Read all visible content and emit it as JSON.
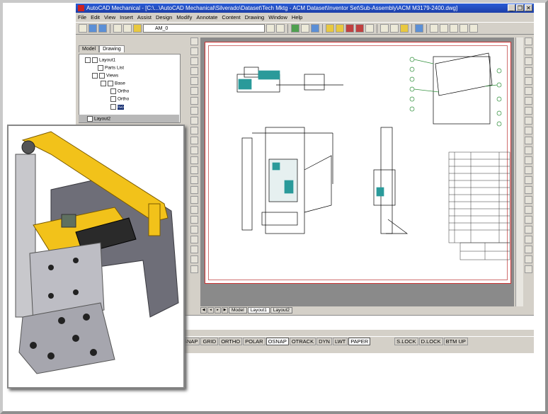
{
  "window": {
    "title": "AutoCAD Mechanical - [C:\\...\\AutoCAD Mechanical\\Silverado\\Dataset\\Tech Mktg - ACM Dataset\\Inventor Set\\Sub-Assembly\\ACM M3179-2400.dwg]",
    "controls": {
      "minimize": "_",
      "restore": "❐",
      "close": "✕"
    }
  },
  "menu": [
    "File",
    "Edit",
    "View",
    "Insert",
    "Assist",
    "Design",
    "Modify",
    "Annotate",
    "Content",
    "Drawing",
    "Window",
    "Help"
  ],
  "toolbar": {
    "layer_value": "AM_0"
  },
  "browser": {
    "tabs": [
      "Model",
      "Drawing"
    ],
    "active_tab": "Drawing",
    "tree": {
      "layout1": "Layout1",
      "parts_list": "Parts List",
      "views": "Views",
      "base": "Base",
      "ortho1": "Ortho",
      "ortho2": "Ortho",
      "iso": "Iso",
      "layout2": "Layout2"
    }
  },
  "layout_tabs": [
    "Model",
    "Layout1",
    "Layout2"
  ],
  "active_layout_tab": "Layout1",
  "status": {
    "toggles": [
      "SNAP",
      "GRID",
      "ORTHO",
      "POLAR",
      "OSNAP",
      "OTRACK",
      "DYN",
      "LWT",
      "PAPER"
    ],
    "on": [
      "OSNAP",
      "PAPER"
    ],
    "right": [
      "S.LOCK",
      "D.LOCK",
      "BTM UP"
    ]
  },
  "colors": {
    "title_bar": "#1c3ea8",
    "sheet_border": "#cc3333",
    "part_yellow": "#f2c21a",
    "teal": "#2a9a9a",
    "green_callout": "#2f8f3a"
  }
}
